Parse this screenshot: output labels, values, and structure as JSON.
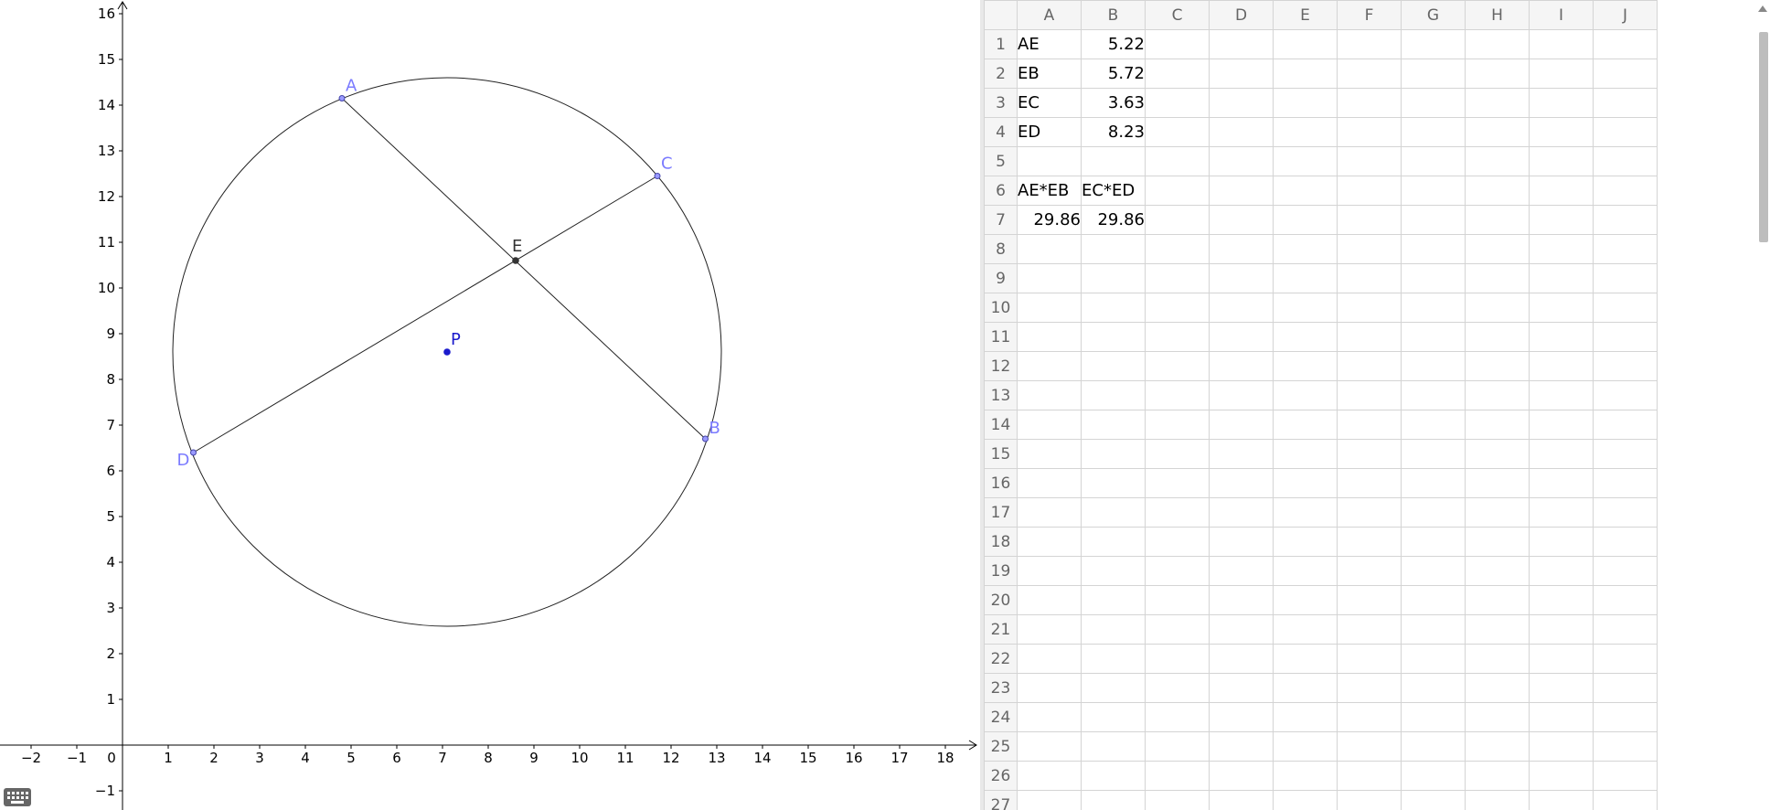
{
  "graph": {
    "x_ticks": [
      "−2",
      "−1",
      "0",
      "1",
      "2",
      "3",
      "4",
      "5",
      "6",
      "7",
      "8",
      "9",
      "10",
      "11",
      "12",
      "13",
      "14",
      "15",
      "16",
      "17",
      "18"
    ],
    "y_ticks": [
      "−1",
      "1",
      "2",
      "3",
      "4",
      "5",
      "6",
      "7",
      "8",
      "9",
      "10",
      "11",
      "12",
      "13",
      "14",
      "15",
      "16"
    ],
    "origin_label": "0",
    "points": [
      {
        "label": "A",
        "x": 4.8,
        "y": 14.15,
        "color": "#7b7bff"
      },
      {
        "label": "B",
        "x": 12.75,
        "y": 6.7,
        "color": "#7b7bff"
      },
      {
        "label": "C",
        "x": 11.7,
        "y": 12.45,
        "color": "#7b7bff"
      },
      {
        "label": "D",
        "x": 1.55,
        "y": 6.4,
        "color": "#7b7bff"
      },
      {
        "label": "E",
        "x": 8.6,
        "y": 10.6,
        "color": "#333333"
      },
      {
        "label": "P",
        "x": 7.1,
        "y": 8.6,
        "color": "#1a1acc"
      }
    ],
    "circle": {
      "cx": 7.1,
      "cy": 8.6,
      "r": 6.0
    }
  },
  "spreadsheet": {
    "columns": [
      "A",
      "B",
      "C",
      "D",
      "E",
      "F",
      "G",
      "H",
      "I",
      "J"
    ],
    "rows": [
      "1",
      "2",
      "3",
      "4",
      "5",
      "6",
      "7",
      "8",
      "9",
      "10",
      "11",
      "12",
      "13",
      "14",
      "15",
      "16",
      "17",
      "18",
      "19",
      "20",
      "21",
      "22",
      "23",
      "24",
      "25",
      "26",
      "27"
    ],
    "cells": {
      "1": [
        "AE",
        "5.22"
      ],
      "2": [
        "EB",
        "5.72"
      ],
      "3": [
        "EC",
        "3.63"
      ],
      "4": [
        "ED",
        "8.23"
      ],
      "5": [
        "",
        ""
      ],
      "6": [
        "AE*EB",
        "EC*ED"
      ],
      "7": [
        "29.86",
        "29.86"
      ]
    }
  },
  "colors": {
    "axis": "#000000",
    "point_dark": "#333333",
    "header_bg": "#f5f5f5",
    "grid_line": "#d4d4d4"
  },
  "icons": {
    "keyboard": "keyboard-icon"
  }
}
